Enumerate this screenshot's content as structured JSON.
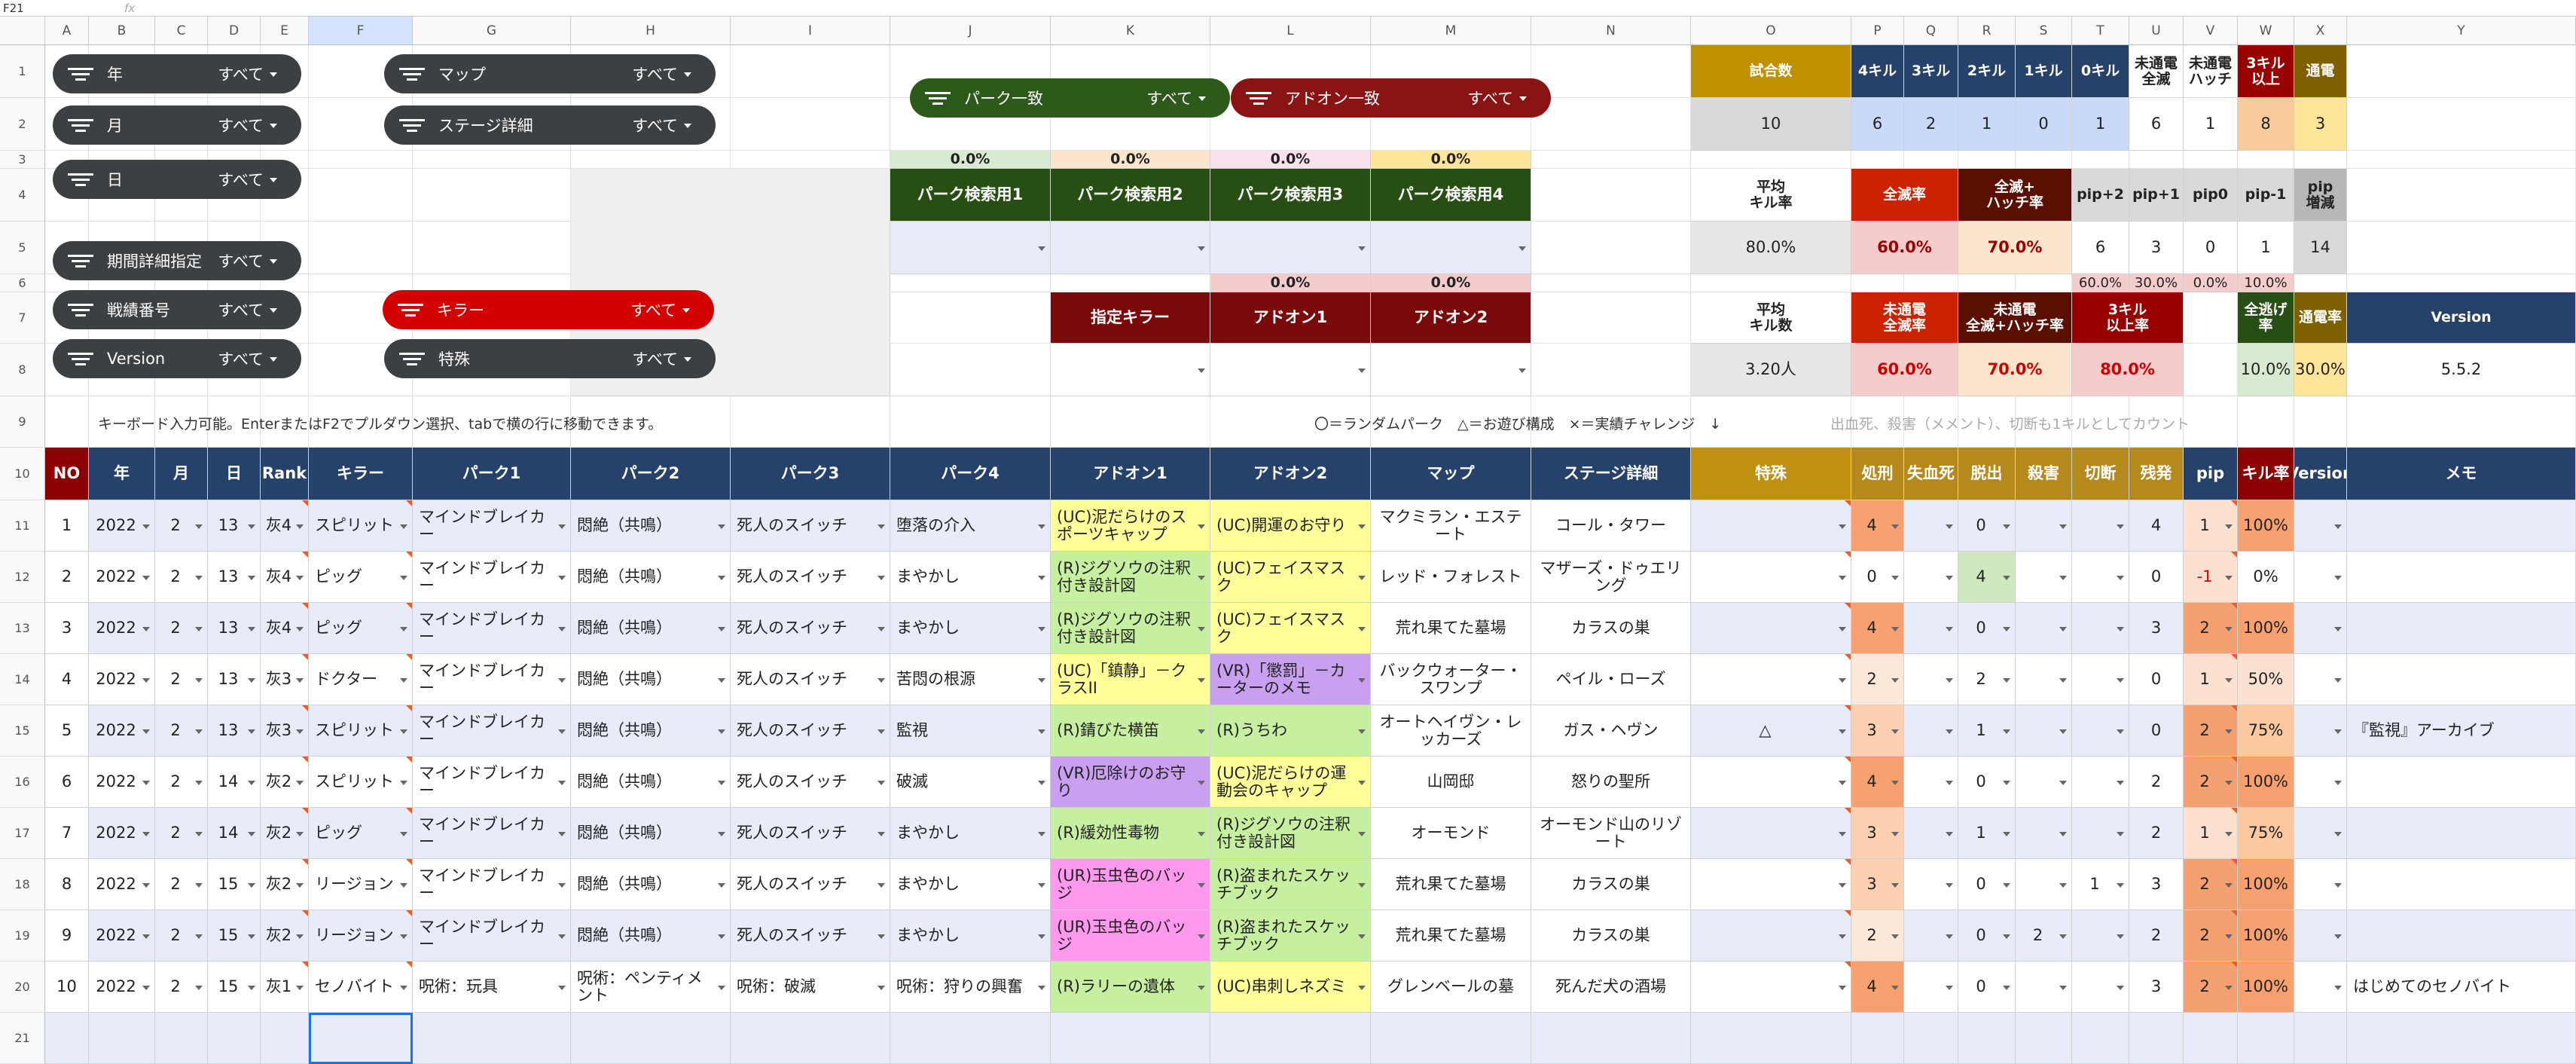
{
  "cell_ref": "F21",
  "fx_label": "fx",
  "columns": [
    "A",
    "B",
    "C",
    "D",
    "E",
    "F",
    "G",
    "H",
    "I",
    "J",
    "K",
    "L",
    "M",
    "N",
    "O",
    "P",
    "Q",
    "R",
    "S",
    "T",
    "U",
    "V",
    "W",
    "X",
    "Y"
  ],
  "row_numbers": [
    "1",
    "2",
    "3",
    "4",
    "5",
    "6",
    "7",
    "8",
    "9",
    "10",
    "11",
    "12",
    "13",
    "14",
    "15",
    "16",
    "17",
    "18",
    "19",
    "20",
    "21"
  ],
  "filters": [
    {
      "label": "年",
      "value": "すべて"
    },
    {
      "label": "月",
      "value": "すべて"
    },
    {
      "label": "日",
      "value": "すべて"
    },
    {
      "label": "期間詳細指定",
      "value": "すべて"
    },
    {
      "label": "戦績番号",
      "value": "すべて"
    },
    {
      "label": "Version",
      "value": "すべて"
    },
    {
      "label": "マップ",
      "value": "すべて"
    },
    {
      "label": "ステージ詳細",
      "value": "すべて"
    },
    {
      "label": "キラー",
      "value": "すべて"
    },
    {
      "label": "特殊",
      "value": "すべて"
    },
    {
      "label": "パーク一致",
      "value": "すべて"
    },
    {
      "label": "アドオン一致",
      "value": "すべて"
    }
  ],
  "search": {
    "perk_pcts": [
      "0.0%",
      "0.0%",
      "0.0%",
      "0.0%"
    ],
    "perk_headers": [
      "パーク検索用1",
      "パーク検索用2",
      "パーク検索用3",
      "パーク検索用4"
    ],
    "addon_pcts": [
      "0.0%",
      "0.0%"
    ],
    "addon_headers": [
      "指定キラー",
      "アドオン1",
      "アドオン2"
    ]
  },
  "stats": {
    "h1": [
      "試合数",
      "4キル",
      "3キル",
      "2キル",
      "1キル",
      "0キル",
      "未通電\n全滅",
      "未通電\nハッチ",
      "3キル\n以上",
      "通電"
    ],
    "v1": [
      "10",
      "6",
      "2",
      "1",
      "0",
      "1",
      "6",
      "1",
      "8",
      "3"
    ],
    "h2": [
      "平均\nキル率",
      "全滅率",
      "全滅+\nハッチ率",
      "pip+2",
      "pip+1",
      "pip0",
      "pip-1",
      "pip\n増減"
    ],
    "v2": [
      "80.0%",
      "60.0%",
      "70.0%",
      "6",
      "3",
      "0",
      "1",
      "14"
    ],
    "pip_pcts": [
      "60.0%",
      "30.0%",
      "0.0%",
      "10.0%"
    ],
    "h3": [
      "平均\nキル数",
      "未通電\n全滅率",
      "未通電\n全滅+ハッチ率",
      "3キル\n以上率",
      "全逃げ\n率",
      "通電率",
      "Version"
    ],
    "v3": [
      "3.20人",
      "60.0%",
      "70.0%",
      "80.0%",
      "10.0%",
      "30.0%",
      "5.5.2"
    ]
  },
  "notes": {
    "keyboard": "キーボード入力可能。EnterまたはF2でプルダウン選択、tabで横の行に移動できます。",
    "legend": "〇＝ランダムパーク　△＝お遊び構成　×＝実績チャレンジ　↓",
    "kill_note": "出血死、殺害（メメント）、切断も1キルとしてカウント"
  },
  "table": {
    "headers": [
      "NO",
      "年",
      "月",
      "日",
      "Rank",
      "キラー",
      "パーク1",
      "パーク2",
      "パーク3",
      "パーク4",
      "アドオン1",
      "アドオン2",
      "マップ",
      "ステージ詳細",
      "特殊",
      "処刑",
      "失血死",
      "脱出",
      "殺害",
      "切断",
      "残発",
      "pip",
      "キル率",
      "Version",
      "メモ"
    ],
    "rows": [
      [
        "1",
        "2022",
        "2",
        "13",
        "灰4",
        "スピリット",
        "マインドブレイカー",
        "悶絶（共鳴）",
        "死人のスイッチ",
        "堕落の介入",
        "(UC)泥だらけのスポーツキャップ",
        "(UC)開運のお守り",
        "マクミラン・エステート",
        "コール・タワー",
        "",
        "4",
        "",
        "0",
        "",
        "",
        "4",
        "1",
        "100%",
        "",
        ""
      ],
      [
        "2",
        "2022",
        "2",
        "13",
        "灰4",
        "ピッグ",
        "マインドブレイカー",
        "悶絶（共鳴）",
        "死人のスイッチ",
        "まやかし",
        "(R)ジグソウの注釈付き設計図",
        "(UC)フェイスマスク",
        "レッド・フォレスト",
        "マザーズ・ドゥエリング",
        "",
        "0",
        "",
        "4",
        "",
        "",
        "0",
        "-1",
        "0%",
        "",
        ""
      ],
      [
        "3",
        "2022",
        "2",
        "13",
        "灰4",
        "ピッグ",
        "マインドブレイカー",
        "悶絶（共鳴）",
        "死人のスイッチ",
        "まやかし",
        "(R)ジグソウの注釈付き設計図",
        "(UC)フェイスマスク",
        "荒れ果てた墓場",
        "カラスの巣",
        "",
        "4",
        "",
        "0",
        "",
        "",
        "3",
        "2",
        "100%",
        "",
        ""
      ],
      [
        "4",
        "2022",
        "2",
        "13",
        "灰3",
        "ドクター",
        "マインドブレイカー",
        "悶絶（共鳴）",
        "死人のスイッチ",
        "苦悶の根源",
        "(UC)「鎮静」－クラスII",
        "(VR)「懲罰」－カーターのメモ",
        "バックウォーター・スワンプ",
        "ペイル・ローズ",
        "",
        "2",
        "",
        "2",
        "",
        "",
        "0",
        "1",
        "50%",
        "",
        ""
      ],
      [
        "5",
        "2022",
        "2",
        "13",
        "灰3",
        "スピリット",
        "マインドブレイカー",
        "悶絶（共鳴）",
        "死人のスイッチ",
        "監視",
        "(R)錆びた横笛",
        "(R)うちわ",
        "オートヘイヴン・レッカーズ",
        "ガス・ヘヴン",
        "△",
        "3",
        "",
        "1",
        "",
        "",
        "0",
        "2",
        "75%",
        "",
        "『監視』アーカイブ"
      ],
      [
        "6",
        "2022",
        "2",
        "14",
        "灰2",
        "スピリット",
        "マインドブレイカー",
        "悶絶（共鳴）",
        "死人のスイッチ",
        "破滅",
        "(VR)厄除けのお守り",
        "(UC)泥だらけの運動会のキャップ",
        "山岡邸",
        "怒りの聖所",
        "",
        "4",
        "",
        "0",
        "",
        "",
        "2",
        "2",
        "100%",
        "",
        ""
      ],
      [
        "7",
        "2022",
        "2",
        "14",
        "灰2",
        "ピッグ",
        "マインドブレイカー",
        "悶絶（共鳴）",
        "死人のスイッチ",
        "まやかし",
        "(R)緩効性毒物",
        "(R)ジグソウの注釈付き設計図",
        "オーモンド",
        "オーモンド山のリゾート",
        "",
        "3",
        "",
        "1",
        "",
        "",
        "2",
        "1",
        "75%",
        "",
        ""
      ],
      [
        "8",
        "2022",
        "2",
        "15",
        "灰2",
        "リージョン",
        "マインドブレイカー",
        "悶絶（共鳴）",
        "死人のスイッチ",
        "まやかし",
        "(UR)玉虫色のバッジ",
        "(R)盗まれたスケッチブック",
        "荒れ果てた墓場",
        "カラスの巣",
        "",
        "3",
        "",
        "0",
        "",
        "1",
        "3",
        "2",
        "100%",
        "",
        ""
      ],
      [
        "9",
        "2022",
        "2",
        "15",
        "灰2",
        "リージョン",
        "マインドブレイカー",
        "悶絶（共鳴）",
        "死人のスイッチ",
        "まやかし",
        "(UR)玉虫色のバッジ",
        "(R)盗まれたスケッチブック",
        "荒れ果てた墓場",
        "カラスの巣",
        "",
        "2",
        "",
        "0",
        "2",
        "",
        "2",
        "2",
        "100%",
        "",
        ""
      ],
      [
        "10",
        "2022",
        "2",
        "15",
        "灰1",
        "セノバイト",
        "呪術：玩具",
        "呪術：ペンティメント",
        "呪術：破滅",
        "呪術：狩りの興奮",
        "(R)ラリーの遺体",
        "(UC)串刺しネズミ",
        "グレンベールの墓",
        "死んだ犬の酒場",
        "",
        "4",
        "",
        "0",
        "",
        "",
        "3",
        "2",
        "100%",
        "",
        "はじめてのセノバイト"
      ]
    ]
  },
  "colors": {
    "header_navy": "#26416a",
    "chip_gray": "#3c4043",
    "green_chip": "#2d5a1b",
    "red_chip": "#8a1414",
    "killer_red": "#d40000"
  }
}
